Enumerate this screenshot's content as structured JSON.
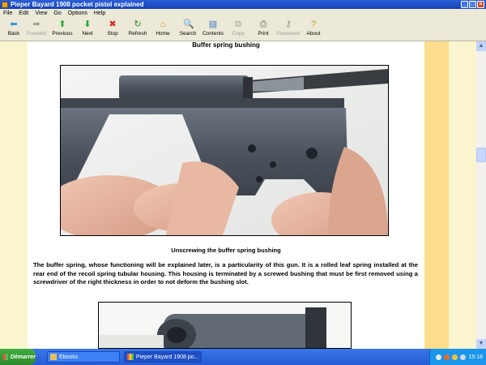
{
  "window": {
    "title": "Pieper Bayard 1908 pocket pistol explained",
    "controls": {
      "minimize": "_",
      "maximize": "□",
      "close": "×"
    }
  },
  "menu": {
    "items": [
      "File",
      "Edit",
      "View",
      "Go",
      "Options",
      "Help"
    ]
  },
  "toolbar": {
    "buttons": [
      {
        "label": "Back",
        "icon": "back-arrow-icon",
        "glyph": "⬅",
        "color": "#2a8ad9",
        "enabled": true
      },
      {
        "label": "Forward",
        "icon": "forward-arrow-icon",
        "glyph": "➡",
        "color": "#9a9a9a",
        "enabled": false
      },
      {
        "label": "Previous",
        "icon": "up-arrow-icon",
        "glyph": "⬆",
        "color": "#2aa52a",
        "enabled": true
      },
      {
        "label": "Next",
        "icon": "down-arrow-icon",
        "glyph": "⬇",
        "color": "#2aa52a",
        "enabled": true
      },
      {
        "label": "Stop",
        "icon": "stop-icon",
        "glyph": "✖",
        "color": "#d42a2a",
        "enabled": true
      },
      {
        "label": "Refresh",
        "icon": "refresh-icon",
        "glyph": "↻",
        "color": "#2a8a2a",
        "enabled": true
      },
      {
        "label": "Home",
        "icon": "home-icon",
        "glyph": "⌂",
        "color": "#c28a1a",
        "enabled": true
      },
      {
        "label": "Search",
        "icon": "search-icon",
        "glyph": "🔍",
        "color": "#3a6ad4",
        "enabled": true
      },
      {
        "label": "Contents",
        "icon": "contents-icon",
        "glyph": "▤",
        "color": "#3a7ac4",
        "enabled": true
      },
      {
        "label": "Copy",
        "icon": "copy-icon",
        "glyph": "⧉",
        "color": "#9a9a9a",
        "enabled": false
      },
      {
        "label": "Print",
        "icon": "print-icon",
        "glyph": "⎙",
        "color": "#555555",
        "enabled": true
      },
      {
        "label": "Password",
        "icon": "key-icon",
        "glyph": "⚷",
        "color": "#9a9a9a",
        "enabled": false
      },
      {
        "label": "About",
        "icon": "about-icon",
        "glyph": "?",
        "color": "#c2a21a",
        "enabled": true
      }
    ]
  },
  "content": {
    "section_title": "Buffer spring bushing",
    "caption": "Unscrewing the buffer spring bushing",
    "paragraph": "The buffer spring, whose functioning will be explained later, is a particularity of this gun. It is a rolled leaf spring installed at the rear end of the recoil spring tubular housing. This housing is terminated by a screwed bushing that must be first removed using a screwdriver of the right thickness in order to not deform the bushing slot."
  },
  "scrollbar": {
    "up": "▲",
    "down": "▼"
  },
  "taskbar": {
    "start_label": "Démarrer",
    "tasks": [
      {
        "label": "Ebooks",
        "active": false
      },
      {
        "label": "Pieper Bayard 1908 po...",
        "active": true
      }
    ],
    "clock": "15:18"
  },
  "colors": {
    "titlebar": "#2a5fd6",
    "page_margin": "#fbf5cf",
    "page_margin_accent": "#fcdd8c",
    "taskbar": "#245dd6"
  }
}
